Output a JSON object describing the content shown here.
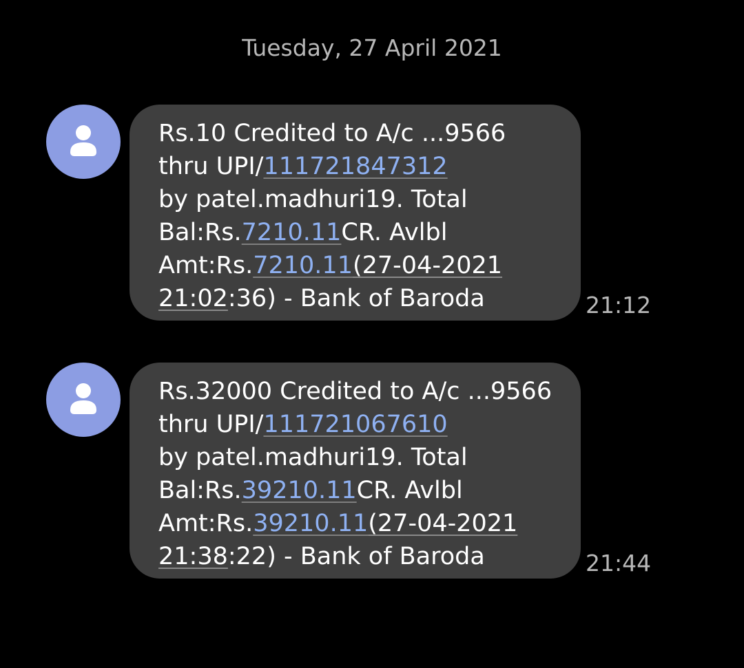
{
  "date_header": "Tuesday, 27 April 2021",
  "colors": {
    "background": "#000000",
    "bubble": "#3f3f3f",
    "avatar": "#8c9de3",
    "link": "#8fb1f2",
    "text": "#ffffff",
    "meta_text": "#b8b8b8"
  },
  "messages": [
    {
      "avatar_icon": "person-icon",
      "time": "21:12",
      "lines": [
        {
          "text": "Rs.10 Credited to A/c ...9566"
        },
        {
          "pre": "thru UPI/",
          "link": "111721847312"
        },
        {
          "text": "by patel.madhuri19. Total"
        },
        {
          "pre": "Bal:Rs.",
          "link": "7210.11",
          "post": "CR. Avlbl"
        },
        {
          "pre": "Amt:Rs.",
          "link": "7210.11",
          "date": "(27-04-2021"
        },
        {
          "clock": "21:02",
          "post": ":36) - Bank of Baroda"
        }
      ]
    },
    {
      "avatar_icon": "person-icon",
      "time": "21:44",
      "lines": [
        {
          "text": "Rs.32000 Credited to A/c ...9566"
        },
        {
          "pre": "thru UPI/",
          "link": "111721067610"
        },
        {
          "text": "by patel.madhuri19. Total"
        },
        {
          "pre": "Bal:Rs.",
          "link": "39210.11",
          "post": "CR. Avlbl"
        },
        {
          "pre": "Amt:Rs.",
          "link": "39210.11",
          "date": "(27-04-2021"
        },
        {
          "clock": "21:38",
          "post": ":22) - Bank of Baroda"
        }
      ]
    }
  ]
}
